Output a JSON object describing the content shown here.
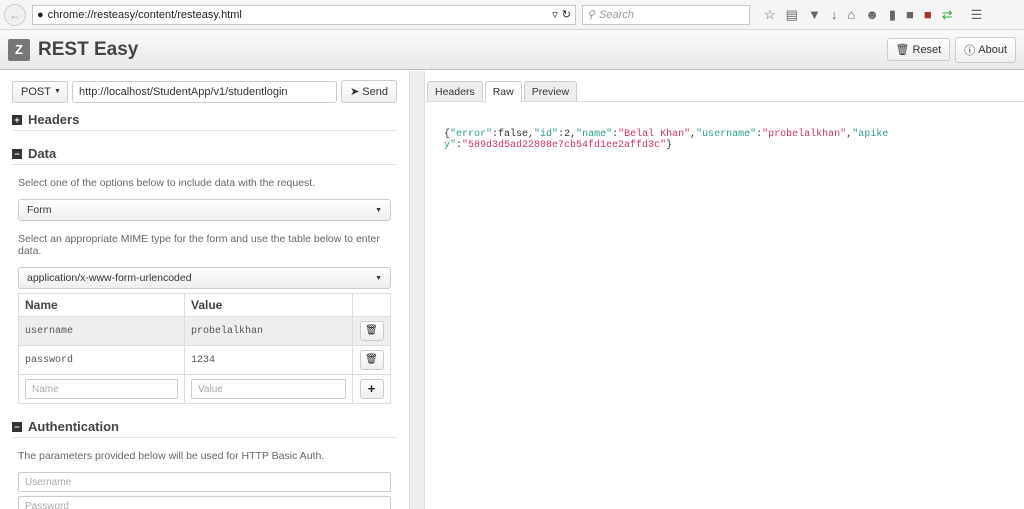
{
  "browser": {
    "url": "chrome://resteasy/content/resteasy.html",
    "search_placeholder": "Search"
  },
  "app": {
    "title": "REST Easy",
    "logo": "Z",
    "reset": "Reset",
    "about": "About"
  },
  "request": {
    "method": "POST",
    "url": "http://localhost/StudentApp/v1/studentlogin",
    "send": "Send"
  },
  "sections": {
    "headers": "Headers",
    "data": "Data",
    "auth": "Authentication"
  },
  "data": {
    "help1": "Select one of the options below to include data with the request.",
    "type": "Form",
    "help2": "Select an appropriate MIME type for the form and use the table below to enter data.",
    "mime": "application/x-www-form-urlencoded",
    "col_name": "Name",
    "col_value": "Value",
    "rows": [
      {
        "name": "username",
        "value": "probelalkhan"
      },
      {
        "name": "password",
        "value": "1234"
      }
    ],
    "name_placeholder": "Name",
    "value_placeholder": "Value"
  },
  "auth": {
    "help": "The parameters provided below will be used for HTTP Basic Auth.",
    "username_placeholder": "Username",
    "password_placeholder": "Password"
  },
  "response": {
    "tabs": [
      "Headers",
      "Raw",
      "Preview"
    ],
    "json": [
      [
        "p",
        "{"
      ],
      [
        "k",
        "\"error\""
      ],
      [
        "p",
        ":false,"
      ],
      [
        "k",
        "\"id\""
      ],
      [
        "p",
        ":2,"
      ],
      [
        "k",
        "\"name\""
      ],
      [
        "p",
        ":"
      ],
      [
        "s",
        "\"Belal Khan\""
      ],
      [
        "p",
        ","
      ],
      [
        "k",
        "\"username\""
      ],
      [
        "p",
        ":"
      ],
      [
        "s",
        "\"probelalkhan\""
      ],
      [
        "p",
        ","
      ],
      [
        "k",
        "\"apikey\""
      ],
      [
        "p",
        ":"
      ],
      [
        "s",
        "\"589d3d5ad22808e7cb54fd1ee2affd3c\""
      ],
      [
        "p",
        "}"
      ]
    ]
  }
}
